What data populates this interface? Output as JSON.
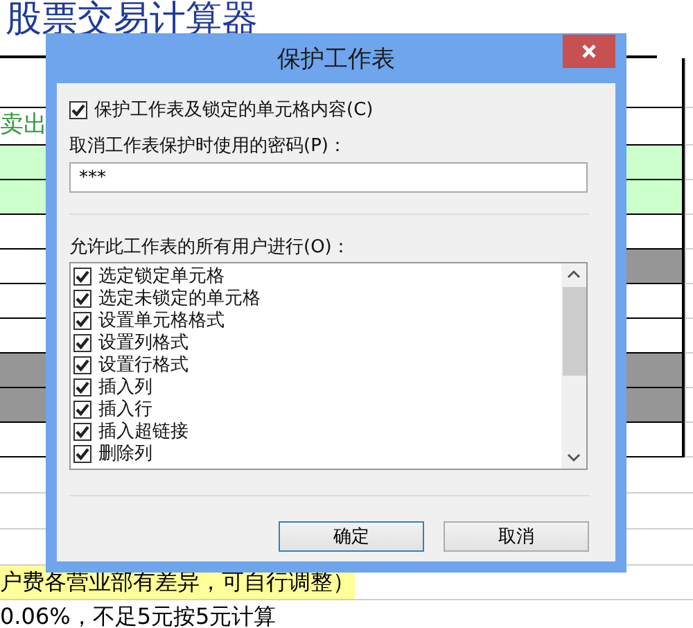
{
  "sheet": {
    "title": "股票交易计算器",
    "rows": [
      {
        "cells": [
          {
            "color": "#ffffff"
          },
          {
            "color": "#ffffff"
          }
        ]
      },
      {
        "cells": [
          {
            "color": "#ffffff",
            "text": "卖出"
          },
          {
            "color": "#ffffff"
          }
        ]
      },
      {
        "cells": [
          {
            "color": "#ccffcc"
          },
          {
            "color": "#ccffcc"
          }
        ]
      },
      {
        "cells": [
          {
            "color": "#ccffcc"
          },
          {
            "color": "#ccffcc"
          }
        ]
      },
      {
        "cells": [
          {
            "color": "#ffffff"
          },
          {
            "color": "#ffffff"
          }
        ]
      },
      {
        "cells": [
          {
            "color": "#ffffff"
          },
          {
            "color": "#969696"
          }
        ]
      },
      {
        "cells": [
          {
            "color": "#ffffff"
          },
          {
            "color": "#ffffff"
          }
        ]
      },
      {
        "cells": [
          {
            "color": "#ffffff"
          },
          {
            "color": "#ffffff"
          }
        ]
      },
      {
        "cells": [
          {
            "color": "#969696"
          },
          {
            "color": "#969696"
          }
        ]
      },
      {
        "cells": [
          {
            "color": "#969696"
          },
          {
            "color": "#969696"
          }
        ]
      },
      {
        "cells": [
          {
            "color": "#ffffff"
          },
          {
            "color": "#ffffff"
          }
        ]
      }
    ],
    "notes": [
      {
        "text": "户费各营业部有差异，可自行调整）",
        "highlighted": true
      },
      {
        "text": "0.06%，不足5元按5元计算",
        "highlighted": false
      }
    ]
  },
  "dialog": {
    "title": "保护工作表",
    "protect": {
      "label": "保护工作表及锁定的单元格内容(C)",
      "checked": true
    },
    "password": {
      "label": "取消工作表保护时使用的密码(P)：",
      "value": "***"
    },
    "permissions_label": "允许此工作表的所有用户进行(O)：",
    "permissions": [
      {
        "label": "选定锁定单元格",
        "checked": true
      },
      {
        "label": "选定未锁定的单元格",
        "checked": true
      },
      {
        "label": "设置单元格格式",
        "checked": true
      },
      {
        "label": "设置列格式",
        "checked": true
      },
      {
        "label": "设置行格式",
        "checked": true
      },
      {
        "label": "插入列",
        "checked": true
      },
      {
        "label": "插入行",
        "checked": true
      },
      {
        "label": "插入超链接",
        "checked": true
      },
      {
        "label": "删除列",
        "checked": true
      }
    ],
    "buttons": [
      {
        "label": "确定",
        "selected": true
      },
      {
        "label": "取消",
        "selected": false
      }
    ]
  }
}
